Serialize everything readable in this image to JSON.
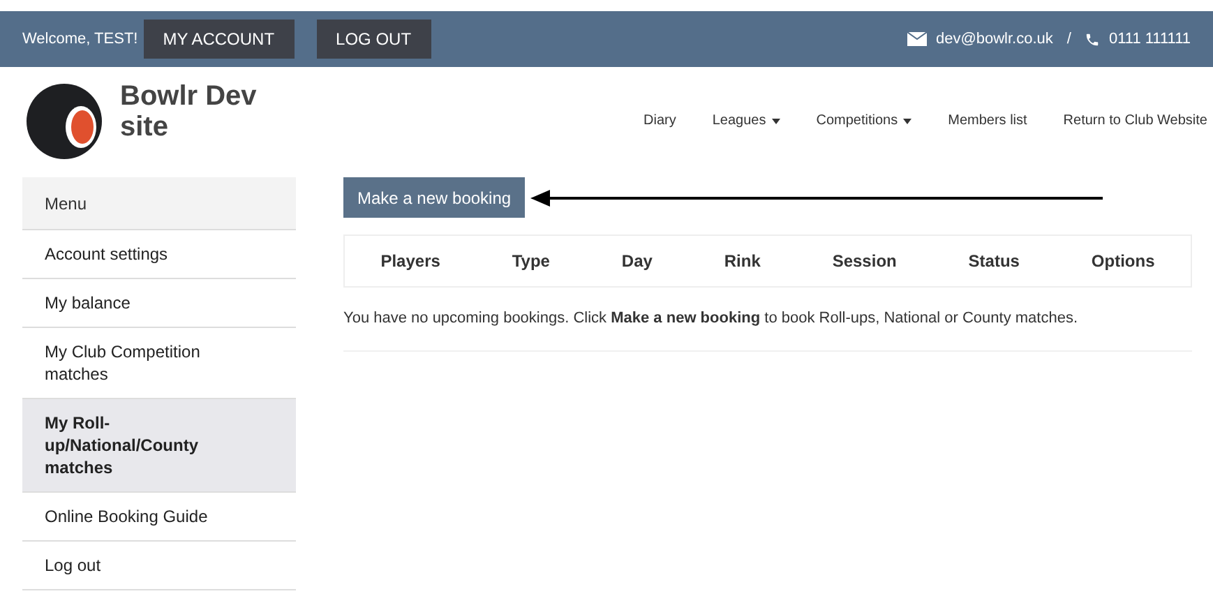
{
  "top_bar": {
    "welcome": "Welcome, TEST!",
    "buttons": [
      "MY ACCOUNT",
      "LOG OUT"
    ],
    "email": "dev@bowlr.co.uk",
    "separator": "/",
    "phone": "0111 111111"
  },
  "site": {
    "name": "Bowlr Dev site"
  },
  "nav": [
    {
      "label": "Diary",
      "dropdown": false
    },
    {
      "label": "Leagues",
      "dropdown": true
    },
    {
      "label": "Competitions",
      "dropdown": true
    },
    {
      "label": "Members list",
      "dropdown": false
    },
    {
      "label": "Return to Club Website",
      "dropdown": false
    }
  ],
  "sidebar": {
    "title": "Menu",
    "items": [
      {
        "label": "Account settings",
        "selected": false
      },
      {
        "label": "My balance",
        "selected": false
      },
      {
        "label": "My Club Competition matches",
        "selected": false
      },
      {
        "label": "My Roll-up/National/County matches",
        "selected": true
      },
      {
        "label": "Online Booking Guide",
        "selected": false
      },
      {
        "label": "Log out",
        "selected": false
      }
    ]
  },
  "new_booking_button": "Make a new booking",
  "table": {
    "columns": [
      "Players",
      "Type",
      "Day",
      "Rink",
      "Session",
      "Status",
      "Options"
    ]
  },
  "empty_message": "You have no upcoming bookings. Click **Make a new booking** to book Roll-ups, National or County matches."
}
